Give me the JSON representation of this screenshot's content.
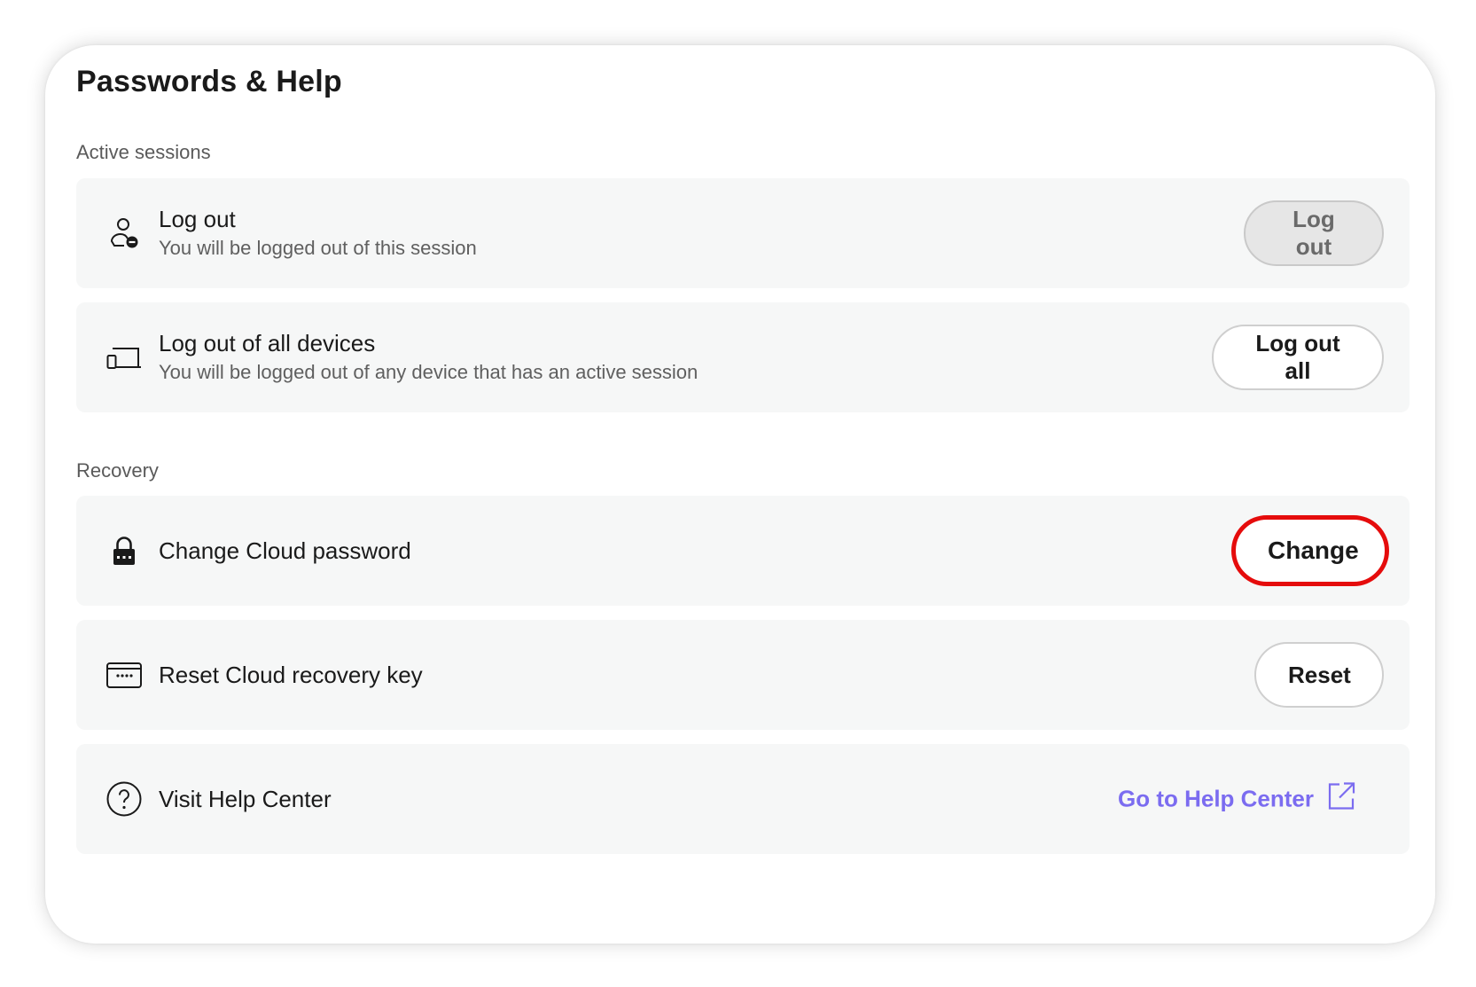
{
  "page": {
    "title": "Passwords & Help"
  },
  "sections": {
    "active_sessions": "Active sessions",
    "recovery": "Recovery"
  },
  "rows": {
    "logout": {
      "title": "Log out",
      "subtitle": "You will be logged out of this session",
      "button": "Log out",
      "icon": "user-minus-icon"
    },
    "logout_all": {
      "title": "Log out of all devices",
      "subtitle": "You will be logged out of any device that has an active session",
      "button": "Log out all",
      "icon": "devices-icon"
    },
    "change_password": {
      "title": "Change Cloud password",
      "button": "Change",
      "icon": "lock-icon"
    },
    "reset_key": {
      "title": "Reset Cloud recovery key",
      "button": "Reset",
      "icon": "key-card-icon"
    },
    "help": {
      "title": "Visit Help Center",
      "link": "Go to Help Center",
      "icon": "question-circle-icon",
      "link_icon": "external-link-icon"
    }
  },
  "colors": {
    "link": "#7b6cf0",
    "highlight": "#e50c0c",
    "row_bg": "#f6f7f7"
  }
}
